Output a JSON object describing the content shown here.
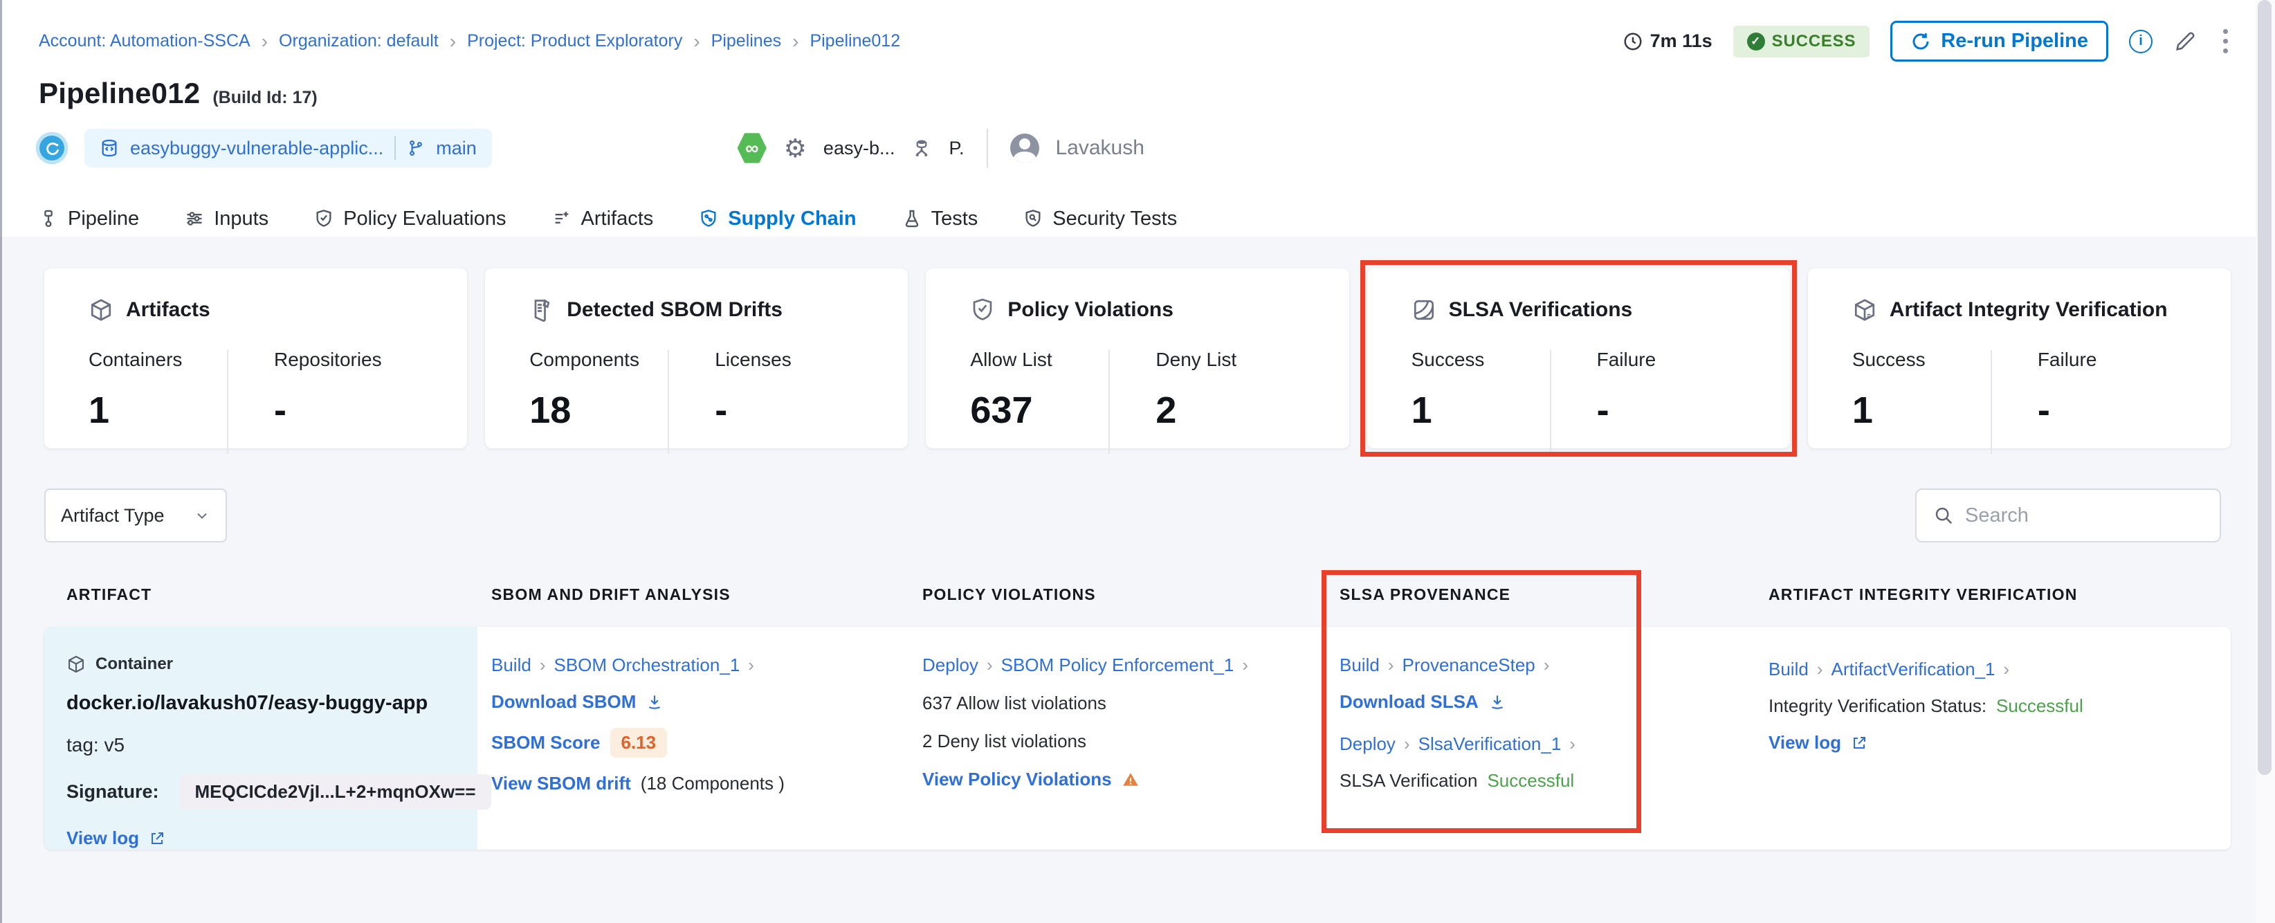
{
  "breadcrumb": {
    "separator": "›",
    "items": [
      "Account: Automation-SSCA",
      "Organization: default",
      "Project: Product Exploratory",
      "Pipelines",
      "Pipeline012"
    ]
  },
  "header": {
    "title": "Pipeline012",
    "build_id": "(Build Id: 17)",
    "duration": "7m 11s",
    "status_badge": "SUCCESS",
    "rerun_label": "Re-run Pipeline",
    "repo_name": "easybuggy-vulnerable-applic...",
    "branch": "main",
    "trigger_text": "easy-b...",
    "trigger_short": "P.",
    "user_name": "Lavakush"
  },
  "tabs": [
    {
      "label": "Pipeline",
      "active": false
    },
    {
      "label": "Inputs",
      "active": false
    },
    {
      "label": "Policy Evaluations",
      "active": false
    },
    {
      "label": "Artifacts",
      "active": false
    },
    {
      "label": "Supply Chain",
      "active": true
    },
    {
      "label": "Tests",
      "active": false
    },
    {
      "label": "Security Tests",
      "active": false
    }
  ],
  "summary_cards": [
    {
      "title": "Artifacts",
      "icon": "cube-icon",
      "stats": [
        {
          "label": "Containers",
          "value": "1"
        },
        {
          "label": "Repositories",
          "value": "-"
        }
      ]
    },
    {
      "title": "Detected SBOM Drifts",
      "icon": "sbom-document-icon",
      "stats": [
        {
          "label": "Components",
          "value": "18"
        },
        {
          "label": "Licenses",
          "value": "-"
        }
      ]
    },
    {
      "title": "Policy Violations",
      "icon": "shield-check-icon",
      "stats": [
        {
          "label": "Allow List",
          "value": "637"
        },
        {
          "label": "Deny List",
          "value": "2"
        }
      ]
    },
    {
      "title": "SLSA Verifications",
      "icon": "slsa-icon",
      "highlighted": true,
      "stats": [
        {
          "label": "Success",
          "value": "1"
        },
        {
          "label": "Failure",
          "value": "-"
        }
      ]
    },
    {
      "title": "Artifact Integrity Verification",
      "icon": "cube-icon",
      "stats": [
        {
          "label": "Success",
          "value": "1"
        },
        {
          "label": "Failure",
          "value": "-"
        }
      ]
    }
  ],
  "filters": {
    "artifact_type_label": "Artifact Type",
    "search_placeholder": "Search"
  },
  "table": {
    "chevron": "›",
    "columns": [
      "ARTIFACT",
      "SBOM AND DRIFT ANALYSIS",
      "POLICY VIOLATIONS",
      "SLSA PROVENANCE",
      "ARTIFACT INTEGRITY VERIFICATION"
    ],
    "row": {
      "artifact": {
        "type_label": "Container",
        "image": "docker.io/lavakush07/easy-buggy-app",
        "tag": "tag: v5",
        "signature_label": "Signature:",
        "signature_value": "MEQCICde2VjI...L+2+mqnOXw==",
        "view_log": "View log"
      },
      "sbom": {
        "stage": "Build",
        "step": "SBOM Orchestration_1",
        "download_label": "Download SBOM",
        "score_label": "SBOM Score",
        "score_value": "6.13",
        "drift_link": "View SBOM drift",
        "drift_note": "(18 Components )"
      },
      "policy": {
        "stage": "Deploy",
        "step": "SBOM Policy Enforcement_1",
        "allow_text": "637 Allow list violations",
        "deny_text": "2 Deny list violations",
        "view_link": "View Policy Violations"
      },
      "slsa": {
        "stage1": "Build",
        "step1": "ProvenanceStep",
        "download_label": "Download SLSA",
        "stage2": "Deploy",
        "step2": "SlsaVerification_1",
        "status_label": "SLSA Verification",
        "status_value": "Successful"
      },
      "integrity": {
        "stage": "Build",
        "step": "ArtifactVerification_1",
        "status_label": "Integrity Verification Status:",
        "status_value": "Successful",
        "view_log": "View log"
      }
    }
  },
  "icons": {
    "gear": "⚙",
    "infinity": "∞",
    "info": "i",
    "check": "✓"
  },
  "colors": {
    "accent_blue": "#0278D5",
    "link_blue": "#2E6FD9",
    "annotation_red": "#E8402A",
    "success_green": "#4CA24C",
    "badge_green_bg": "#E2F1DE",
    "warning_orange": "#E8803D",
    "score_orange": "#E2622B",
    "artifact_cell_bg": "#E7F4FA",
    "page_bg": "#F5F6FA"
  }
}
